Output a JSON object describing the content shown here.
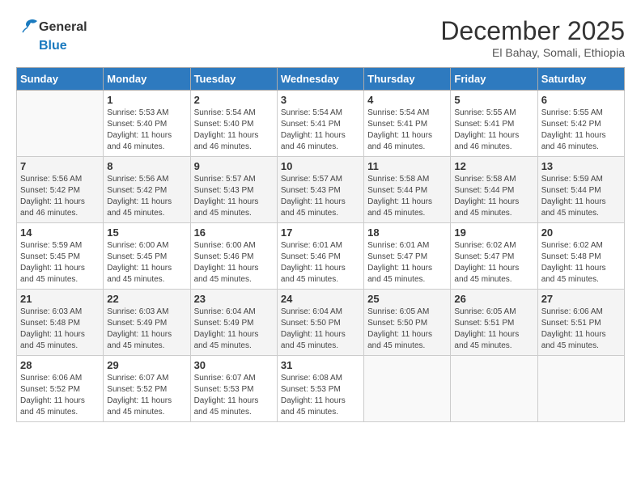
{
  "header": {
    "logo_line1": "General",
    "logo_line2": "Blue",
    "month": "December 2025",
    "location": "El Bahay, Somali, Ethiopia"
  },
  "days_of_week": [
    "Sunday",
    "Monday",
    "Tuesday",
    "Wednesday",
    "Thursday",
    "Friday",
    "Saturday"
  ],
  "weeks": [
    [
      {
        "day": "",
        "info": ""
      },
      {
        "day": "1",
        "info": "Sunrise: 5:53 AM\nSunset: 5:40 PM\nDaylight: 11 hours\nand 46 minutes."
      },
      {
        "day": "2",
        "info": "Sunrise: 5:54 AM\nSunset: 5:40 PM\nDaylight: 11 hours\nand 46 minutes."
      },
      {
        "day": "3",
        "info": "Sunrise: 5:54 AM\nSunset: 5:41 PM\nDaylight: 11 hours\nand 46 minutes."
      },
      {
        "day": "4",
        "info": "Sunrise: 5:54 AM\nSunset: 5:41 PM\nDaylight: 11 hours\nand 46 minutes."
      },
      {
        "day": "5",
        "info": "Sunrise: 5:55 AM\nSunset: 5:41 PM\nDaylight: 11 hours\nand 46 minutes."
      },
      {
        "day": "6",
        "info": "Sunrise: 5:55 AM\nSunset: 5:42 PM\nDaylight: 11 hours\nand 46 minutes."
      }
    ],
    [
      {
        "day": "7",
        "info": "Sunrise: 5:56 AM\nSunset: 5:42 PM\nDaylight: 11 hours\nand 46 minutes."
      },
      {
        "day": "8",
        "info": "Sunrise: 5:56 AM\nSunset: 5:42 PM\nDaylight: 11 hours\nand 45 minutes."
      },
      {
        "day": "9",
        "info": "Sunrise: 5:57 AM\nSunset: 5:43 PM\nDaylight: 11 hours\nand 45 minutes."
      },
      {
        "day": "10",
        "info": "Sunrise: 5:57 AM\nSunset: 5:43 PM\nDaylight: 11 hours\nand 45 minutes."
      },
      {
        "day": "11",
        "info": "Sunrise: 5:58 AM\nSunset: 5:44 PM\nDaylight: 11 hours\nand 45 minutes."
      },
      {
        "day": "12",
        "info": "Sunrise: 5:58 AM\nSunset: 5:44 PM\nDaylight: 11 hours\nand 45 minutes."
      },
      {
        "day": "13",
        "info": "Sunrise: 5:59 AM\nSunset: 5:44 PM\nDaylight: 11 hours\nand 45 minutes."
      }
    ],
    [
      {
        "day": "14",
        "info": "Sunrise: 5:59 AM\nSunset: 5:45 PM\nDaylight: 11 hours\nand 45 minutes."
      },
      {
        "day": "15",
        "info": "Sunrise: 6:00 AM\nSunset: 5:45 PM\nDaylight: 11 hours\nand 45 minutes."
      },
      {
        "day": "16",
        "info": "Sunrise: 6:00 AM\nSunset: 5:46 PM\nDaylight: 11 hours\nand 45 minutes."
      },
      {
        "day": "17",
        "info": "Sunrise: 6:01 AM\nSunset: 5:46 PM\nDaylight: 11 hours\nand 45 minutes."
      },
      {
        "day": "18",
        "info": "Sunrise: 6:01 AM\nSunset: 5:47 PM\nDaylight: 11 hours\nand 45 minutes."
      },
      {
        "day": "19",
        "info": "Sunrise: 6:02 AM\nSunset: 5:47 PM\nDaylight: 11 hours\nand 45 minutes."
      },
      {
        "day": "20",
        "info": "Sunrise: 6:02 AM\nSunset: 5:48 PM\nDaylight: 11 hours\nand 45 minutes."
      }
    ],
    [
      {
        "day": "21",
        "info": "Sunrise: 6:03 AM\nSunset: 5:48 PM\nDaylight: 11 hours\nand 45 minutes."
      },
      {
        "day": "22",
        "info": "Sunrise: 6:03 AM\nSunset: 5:49 PM\nDaylight: 11 hours\nand 45 minutes."
      },
      {
        "day": "23",
        "info": "Sunrise: 6:04 AM\nSunset: 5:49 PM\nDaylight: 11 hours\nand 45 minutes."
      },
      {
        "day": "24",
        "info": "Sunrise: 6:04 AM\nSunset: 5:50 PM\nDaylight: 11 hours\nand 45 minutes."
      },
      {
        "day": "25",
        "info": "Sunrise: 6:05 AM\nSunset: 5:50 PM\nDaylight: 11 hours\nand 45 minutes."
      },
      {
        "day": "26",
        "info": "Sunrise: 6:05 AM\nSunset: 5:51 PM\nDaylight: 11 hours\nand 45 minutes."
      },
      {
        "day": "27",
        "info": "Sunrise: 6:06 AM\nSunset: 5:51 PM\nDaylight: 11 hours\nand 45 minutes."
      }
    ],
    [
      {
        "day": "28",
        "info": "Sunrise: 6:06 AM\nSunset: 5:52 PM\nDaylight: 11 hours\nand 45 minutes."
      },
      {
        "day": "29",
        "info": "Sunrise: 6:07 AM\nSunset: 5:52 PM\nDaylight: 11 hours\nand 45 minutes."
      },
      {
        "day": "30",
        "info": "Sunrise: 6:07 AM\nSunset: 5:53 PM\nDaylight: 11 hours\nand 45 minutes."
      },
      {
        "day": "31",
        "info": "Sunrise: 6:08 AM\nSunset: 5:53 PM\nDaylight: 11 hours\nand 45 minutes."
      },
      {
        "day": "",
        "info": ""
      },
      {
        "day": "",
        "info": ""
      },
      {
        "day": "",
        "info": ""
      }
    ]
  ]
}
